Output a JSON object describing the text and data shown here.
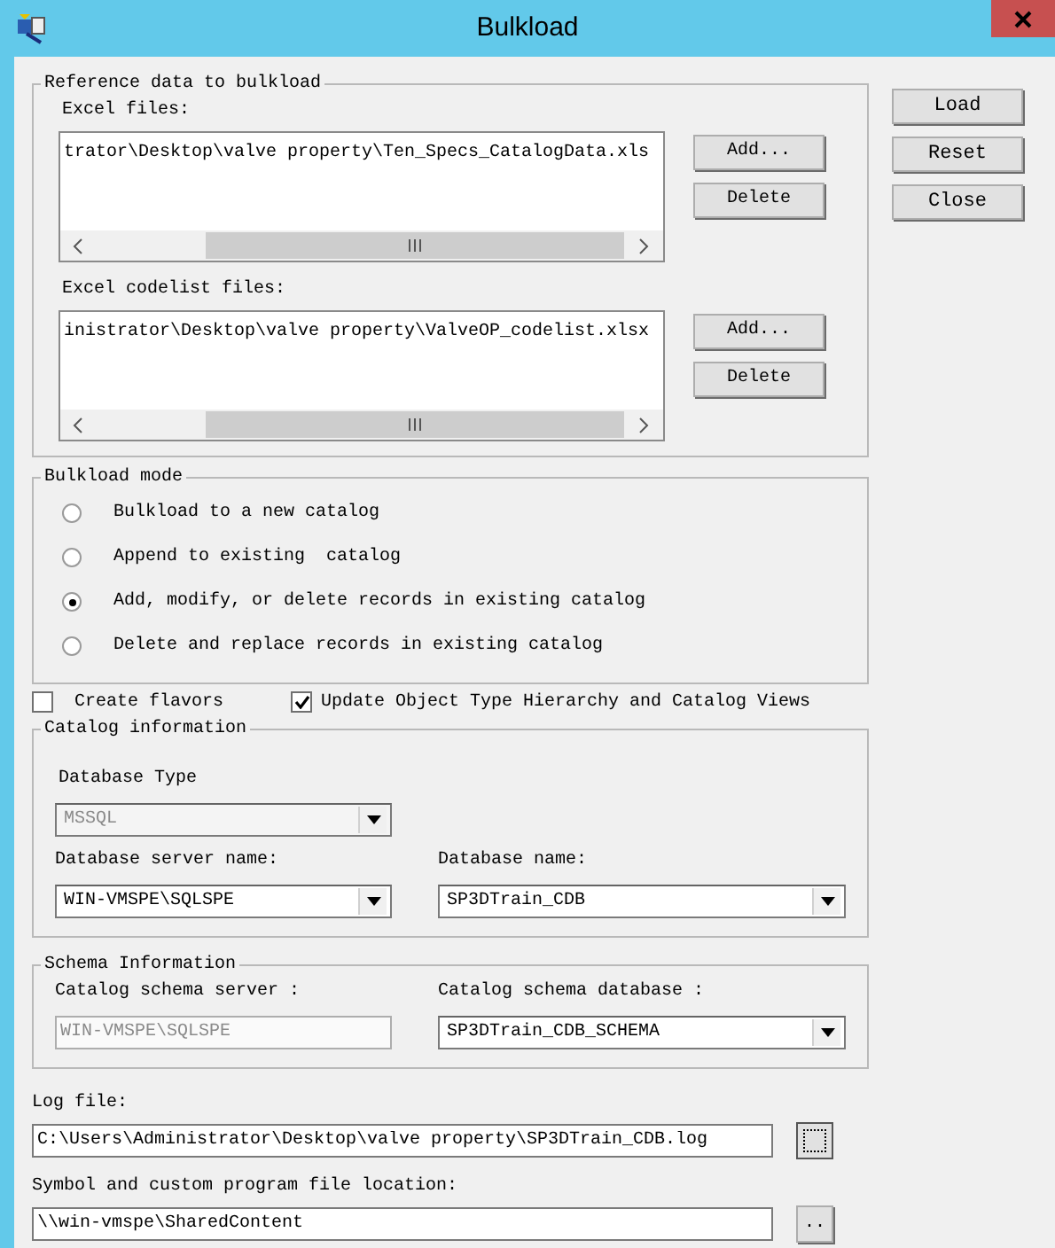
{
  "window": {
    "title": "Bulkload"
  },
  "reference_data": {
    "title": "Reference data to bulkload",
    "lists": [
      {
        "label": "Excel files:",
        "value": "trator\\Desktop\\valve property\\Ten_Specs_CatalogData.xls",
        "buttons": [
          "Add...",
          "Delete"
        ]
      },
      {
        "label": "Excel codelist files:",
        "value": "inistrator\\Desktop\\valve property\\ValveOP_codelist.xlsx",
        "buttons": [
          "Add...",
          "Delete"
        ]
      }
    ]
  },
  "bulkload_mode": {
    "title": "Bulkload mode",
    "options": [
      {
        "label": "Bulkload to a new catalog",
        "selected": false
      },
      {
        "label": "Append to existing  catalog",
        "selected": false
      },
      {
        "label": "Add, modify, or delete records in existing catalog",
        "selected": true
      },
      {
        "label": "Delete and replace records in existing catalog",
        "selected": false
      }
    ]
  },
  "options": [
    {
      "label": "Create flavors",
      "checked": false
    },
    {
      "label": "Update Object Type Hierarchy and Catalog Views",
      "checked": true
    }
  ],
  "catalog_information": {
    "title": "Catalog information",
    "database_type": {
      "label": "Database Type",
      "value": "MSSQL",
      "disabled": true
    },
    "server": {
      "label": "Database server name:",
      "value": "WIN-VMSPE\\SQLSPE",
      "disabled": false
    },
    "database": {
      "label": "Database name:",
      "value": "SP3DTrain_CDB",
      "disabled": false
    }
  },
  "schema_information": {
    "title": "Schema Information",
    "server": {
      "label": "Catalog schema server :",
      "value": "WIN-VMSPE\\SQLSPE",
      "disabled": true
    },
    "database": {
      "label": "Catalog schema database :",
      "value": "SP3DTrain_CDB_SCHEMA",
      "disabled": false
    }
  },
  "log_file": {
    "label": "Log file:",
    "value": "C:\\Users\\Administrator\\Desktop\\valve property\\SP3DTrain_CDB.log"
  },
  "symbol_location": {
    "label": "Symbol and custom program file location:",
    "value": "\\\\win-vmspe\\SharedContent",
    "browse": ".."
  },
  "buttons": [
    "Load",
    "Reset",
    "Close"
  ]
}
